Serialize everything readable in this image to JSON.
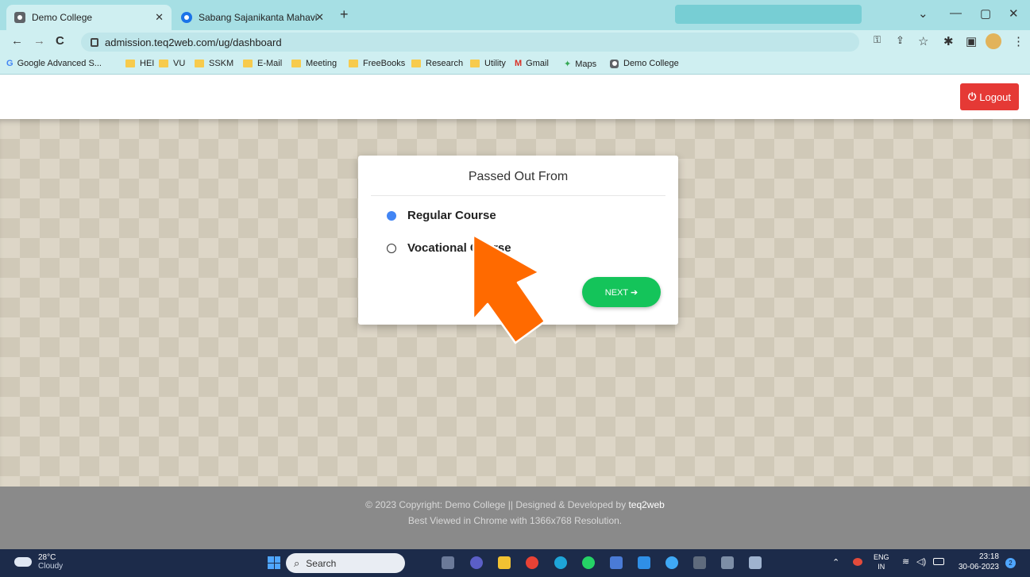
{
  "browser": {
    "tabs": [
      {
        "title": "Demo College",
        "active": true
      },
      {
        "title": "Sabang Sajanikanta Mahavidyala",
        "active": false
      }
    ],
    "new_tab": "+",
    "url": "admission.teq2web.com/ug/dashboard",
    "bookmarks": [
      "Google Advanced S...",
      "HEI",
      "VU",
      "SSKM",
      "E-Mail",
      "Meeting",
      "FreeBooks",
      "Research",
      "Utility",
      "Gmail",
      "Maps",
      "Demo College"
    ]
  },
  "header": {
    "logout_label": "Logout"
  },
  "card": {
    "title": "Passed Out From",
    "options": [
      {
        "label": "Regular Course",
        "selected": true
      },
      {
        "label": "Vocational Course",
        "selected": false
      }
    ],
    "next_label": "NEXT ➔"
  },
  "footer": {
    "line1_prefix": "© 2023 Copyright: Demo College || Designed & Developed by ",
    "line1_brand": "teq2web",
    "line2": "Best Viewed in Chrome with 1366x768 Resolution."
  },
  "taskbar": {
    "weather_temp": "28°C",
    "weather_desc": "Cloudy",
    "search_label": "Search",
    "lang_top": "ENG",
    "lang_bottom": "IN",
    "time": "23:18",
    "date": "30-06-2023",
    "notification_count": "2"
  },
  "colors": {
    "accent_red": "#e53935",
    "next_green": "#14c45a",
    "radio_blue": "#4285f4",
    "arrow": "#ff6a00"
  }
}
